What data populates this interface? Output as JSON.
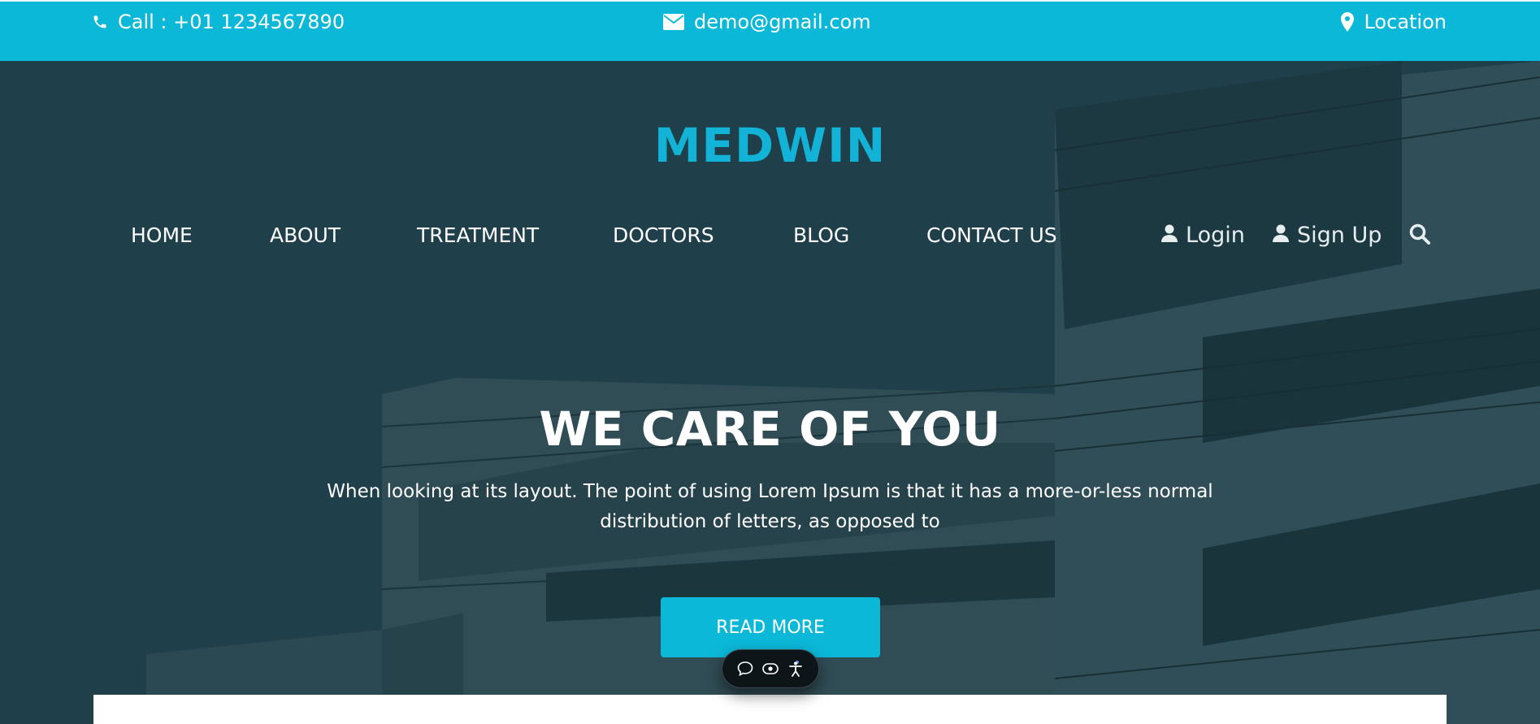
{
  "topbar": {
    "call_text": "Call : +01 1234567890",
    "email_text": "demo@gmail.com",
    "location_text": "Location",
    "background_color": "#0cb8d8"
  },
  "brand": {
    "name": "MEDWIN",
    "color": "#12b3d6"
  },
  "nav": {
    "items": [
      {
        "label": "HOME"
      },
      {
        "label": "ABOUT"
      },
      {
        "label": "TREATMENT"
      },
      {
        "label": "DOCTORS"
      },
      {
        "label": "BLOG"
      },
      {
        "label": "CONTACT US"
      }
    ],
    "login_label": "Login",
    "signup_label": "Sign Up"
  },
  "hero": {
    "title": "WE CARE OF YOU",
    "text": "When looking at its layout. The point of using Lorem Ipsum is that it has a more-or-less normal distribution of letters, as opposed to",
    "button_label": "READ MORE"
  },
  "icons": {
    "phone": "phone-icon",
    "email": "envelope-icon",
    "location": "map-marker-icon",
    "user": "user-icon",
    "search": "search-icon",
    "chat": "chat-icon",
    "view": "eye-icon",
    "accessibility": "accessibility-icon"
  }
}
